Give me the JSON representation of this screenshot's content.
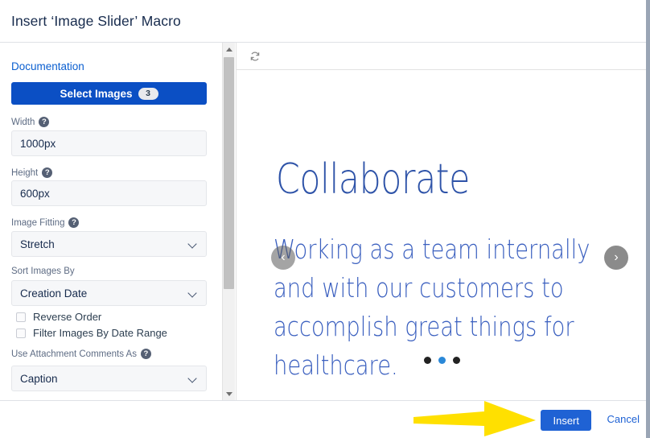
{
  "dialog": {
    "title": "Insert ‘Image Slider’ Macro"
  },
  "form": {
    "documentation_link": "Documentation",
    "select_images_button": "Select Images",
    "select_images_count": "3",
    "help_glyph": "?",
    "fields": [
      {
        "label": "Width",
        "value": "1000px",
        "has_help": true
      },
      {
        "label": "Height",
        "value": "600px",
        "has_help": true
      }
    ],
    "image_fitting": {
      "label": "Image Fitting",
      "value": "Stretch",
      "has_help": true
    },
    "sort_images_by": {
      "label": "Sort Images By",
      "value": "Creation Date",
      "has_help": false
    },
    "checkboxes": [
      {
        "label": "Reverse Order",
        "checked": false
      },
      {
        "label": "Filter Images By Date Range",
        "checked": false
      }
    ],
    "attachment_comments": {
      "label": "Use Attachment Comments As",
      "value": "Caption",
      "has_help": true
    }
  },
  "preview": {
    "refresh_icon": "refresh-icon",
    "slide": {
      "heading": "Collaborate",
      "body": "Working as a team internally and with our customers to accomplish great things for healthcare."
    },
    "prev_label": "‹",
    "next_label": "›",
    "dots": [
      {
        "active": false
      },
      {
        "active": true
      },
      {
        "active": false
      }
    ]
  },
  "footer": {
    "insert_label": "Insert",
    "cancel_label": "Cancel"
  },
  "annotation": {
    "arrow_color": "#ffe000",
    "points_to": "Insert"
  },
  "colors": {
    "primary_blue": "#0b4fc4",
    "link_blue": "#1f62d4",
    "slide_blue": "#2e53a8",
    "active_dot": "#2a88d8",
    "annotation_yellow": "#ffe000"
  }
}
